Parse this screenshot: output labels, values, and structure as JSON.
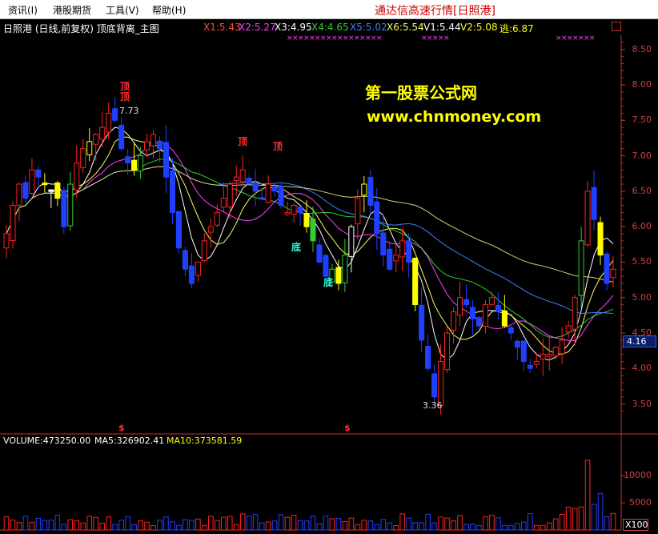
{
  "menu": {
    "items": [
      {
        "label": "资讯(I)"
      },
      {
        "label": "港股期货"
      },
      {
        "label": "工具(V)"
      },
      {
        "label": "帮助(H)"
      }
    ],
    "title": "通达信高速行情[日照港]"
  },
  "chart": {
    "caption": "日照港 (日线,前复权) 顶底背离_主图",
    "indicators": [
      {
        "label": "X1:5.43",
        "color": "#ff5030"
      },
      {
        "label": "X2:5.27",
        "color": "#ff40ff"
      },
      {
        "label": "X3:4.95",
        "color": "#ffffff"
      },
      {
        "label": "X4:4.65",
        "color": "#30d030"
      },
      {
        "label": "X5:5.02",
        "color": "#4080ff"
      },
      {
        "label": "X6:5.54",
        "color": "#ffff60"
      },
      {
        "label": "V1:5.44",
        "color": "#ffffff"
      },
      {
        "label": "V2:5.08",
        "color": "#ffff00"
      },
      {
        "label": "逃:6.87",
        "color": "#ffff00"
      }
    ],
    "watermark": {
      "line1": "第一股票公式网",
      "line2": "www.chnmoney.com"
    },
    "signals_top": [
      "顶",
      "顶",
      "顶",
      "顶"
    ],
    "signals_bottom": [
      "底",
      "底"
    ],
    "price_notes": {
      "high": "7.73",
      "low": "3.36"
    },
    "dollar_marks": [
      "$",
      "$"
    ],
    "current_price": "4.16",
    "x100_label": "X100",
    "colors": {
      "up": "#ff2020",
      "down": "#2040ff",
      "flat": "#ffff00",
      "green": "#30d030",
      "axis": "#c83030"
    }
  },
  "volume": {
    "label": "VOLUME:473250.00",
    "ma5": "MA5:326902.41",
    "ma10": "MA10:373581.59"
  },
  "chart_data": {
    "type": "candlestick",
    "y_axis": [
      8.5,
      8.0,
      7.5,
      7.0,
      6.5,
      6.0,
      5.5,
      5.0,
      4.5,
      4.0,
      3.5
    ],
    "ylim": [
      3.1,
      8.7
    ],
    "volume_axis": [
      10000,
      5000
    ],
    "close_series": [
      5.9,
      6.3,
      6.6,
      6.4,
      6.8,
      6.7,
      6.6,
      6.5,
      6.4,
      6.0,
      6.6,
      6.9,
      7.1,
      7.2,
      7.3,
      7.4,
      7.6,
      7.5,
      7.1,
      6.9,
      6.8,
      7.0,
      7.2,
      7.3,
      7.1,
      6.7,
      6.2,
      5.7,
      5.4,
      5.2,
      5.5,
      5.8,
      6.0,
      6.2,
      6.4,
      6.6,
      6.7,
      6.8,
      6.6,
      6.5,
      6.4,
      6.6,
      6.5,
      6.3,
      6.2,
      6.3,
      6.2,
      6.0,
      5.8,
      5.5,
      5.3,
      5.4,
      5.2,
      5.6,
      6.0,
      6.4,
      6.6,
      6.3,
      5.9,
      5.6,
      5.4,
      5.6,
      5.8,
      5.5,
      4.9,
      4.4,
      4.0,
      3.6,
      4.1,
      4.5,
      4.8,
      5.0,
      4.9,
      4.7,
      4.6,
      4.9,
      5.0,
      4.8,
      4.6,
      4.5,
      4.3,
      4.1,
      4.0,
      4.1,
      4.2,
      4.2,
      4.3,
      4.4,
      4.6,
      5.0,
      5.8,
      6.5,
      6.1,
      5.6,
      5.2,
      5.4
    ],
    "low_marker": 3.36,
    "high_marker": 7.73
  }
}
